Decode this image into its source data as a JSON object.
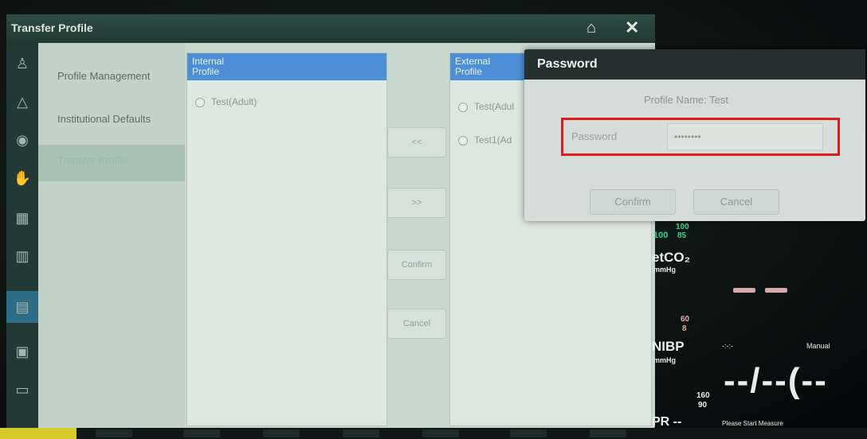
{
  "window": {
    "title": "Transfer Profile"
  },
  "nav": {
    "items": [
      {
        "label": "Profile Management"
      },
      {
        "label": "Institutional Defaults"
      },
      {
        "label": "Transfer Profile"
      }
    ]
  },
  "internal": {
    "header_line1": "Internal",
    "header_line2": "Profile",
    "items": [
      {
        "label": "Test(Adult)"
      }
    ]
  },
  "external": {
    "header_line1": "External",
    "header_line2": "Profile",
    "items": [
      {
        "label": "Test(Adul"
      },
      {
        "label": "Test1(Ad"
      }
    ]
  },
  "actions": {
    "move_left": "<<",
    "move_right": ">>",
    "confirm": "Confirm",
    "cancel": "Cancel"
  },
  "password_dialog": {
    "title": "Password",
    "profile_name": "Profile Name: Test",
    "field_label": "Password",
    "field_value": "••••••••",
    "confirm": "Confirm",
    "cancel": "Cancel"
  },
  "vitals": {
    "spo2_scale_100": "100",
    "spo2_hi": "100",
    "spo2_lo": "85",
    "etco2_label": "etCO₂",
    "etco2_unit": "mmHg",
    "etco2_hi": "60",
    "etco2_lo": "8",
    "nibp_label": "NIBP",
    "nibp_unit": "mmHg",
    "nibp_time": "-:-:-",
    "nibp_mode": "Manual",
    "nibp_value": "--/--(--",
    "nibp_hi": "160",
    "nibp_lo": "90",
    "nibp_prompt": "Please Start Measure",
    "pr_label": "PR --"
  },
  "colors": {
    "accent_blue": "#4d8fd6",
    "highlight_red": "#e01b1b",
    "vital_green": "#37d08a"
  }
}
